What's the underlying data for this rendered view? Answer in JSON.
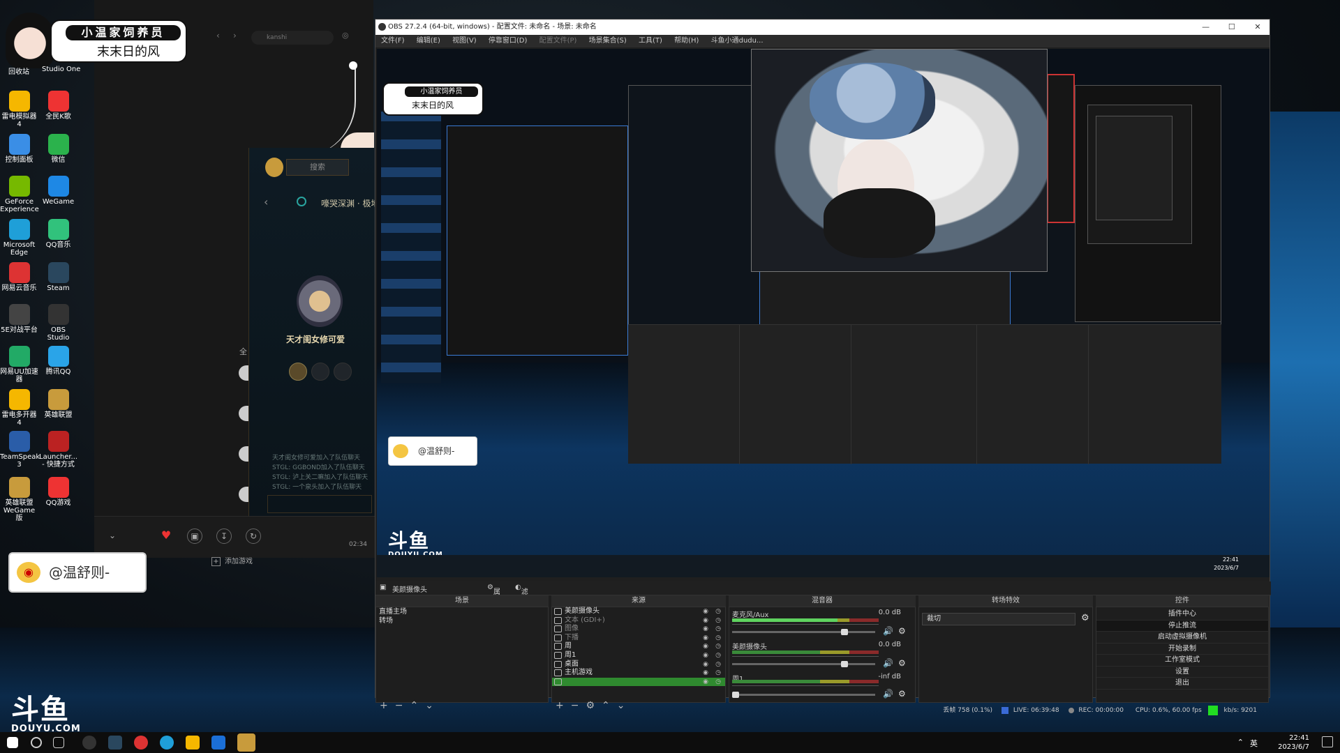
{
  "desktop": {
    "sticker": {
      "line1": "小温家饲养员",
      "line2": "末末日的风"
    },
    "top_labels": [
      "回收站",
      "Studio One"
    ],
    "icons": [
      {
        "label": "雷电模拟器4",
        "color": "#f5b700"
      },
      {
        "label": "全民K歌",
        "color": "#e33"
      },
      {
        "label": "控制面板",
        "color": "#3a8ee6"
      },
      {
        "label": "微信",
        "color": "#2bb24c"
      },
      {
        "label": "GeForce Experience",
        "color": "#76b900"
      },
      {
        "label": "WeGame",
        "color": "#1e88e5"
      },
      {
        "label": "Microsoft Edge",
        "color": "#1f9fd8"
      },
      {
        "label": "QQ音乐",
        "color": "#31c27c"
      },
      {
        "label": "网易云音乐",
        "color": "#d33"
      },
      {
        "label": "Steam",
        "color": "#2a475e"
      },
      {
        "label": "5E对战平台",
        "color": "#444"
      },
      {
        "label": "OBS Studio",
        "color": "#333"
      },
      {
        "label": "网易UU加速器",
        "color": "#2a6"
      },
      {
        "label": "腾讯QQ",
        "color": "#2aa4e8"
      },
      {
        "label": "雷电多开器4",
        "color": "#f5b700"
      },
      {
        "label": "英雄联盟",
        "color": "#c89b3c"
      },
      {
        "label": "TeamSpeak 3",
        "color": "#2a5da8"
      },
      {
        "label": "Launcher... - 快捷方式",
        "color": "#b22"
      },
      {
        "label": "英雄联盟WeGame版",
        "color": "#c89b3c"
      },
      {
        "label": "QQ游戏",
        "color": "#e33"
      }
    ]
  },
  "client": {
    "search_placeholder": "kanshi",
    "lol_search": "搜索",
    "lol_title": "嚎哭深渊 · 极地...",
    "summoner_name": "天才闺女修可爱",
    "side_label": "全",
    "chat_lines": [
      "天才闺女修可爱加入了队伍聊天",
      "STGL: GGBOND加入了队伍聊天",
      "STGL: 泸上关二嘛加入了队伍聊天",
      "STGL: 一个泉头加入了队伍聊天"
    ],
    "time": "02:34",
    "add_game": "添加游戏"
  },
  "weibo": {
    "handle": "@温舒则-"
  },
  "watermark": {
    "brand": "斗鱼",
    "domain": "DOUYU.COM"
  },
  "obs": {
    "title": "OBS 27.2.4 (64-bit, windows) - 配置文件: 未命名 - 场景: 未命名",
    "menu": [
      "文件(F)",
      "编辑(E)",
      "视图(V)",
      "停靠窗口(D)",
      "配置文件(P)",
      "场景集合(S)",
      "工具(T)",
      "帮助(H)",
      "斗鱼小通dudu..."
    ],
    "tabs": {
      "source_name": "美颜摄像头",
      "properties": "属性",
      "filters": "滤镜"
    },
    "docks": {
      "scenes": {
        "title": "场景",
        "items": [
          "直播主场",
          "转场"
        ]
      },
      "sources": {
        "title": "来源",
        "items": [
          {
            "name": "美颜摄像头",
            "selected": false
          },
          {
            "name": "文本 (GDI+)",
            "selected": false
          },
          {
            "name": "图像",
            "selected": false
          },
          {
            "name": "下播",
            "selected": false
          },
          {
            "name": "周",
            "selected": false
          },
          {
            "name": "周1",
            "selected": false
          },
          {
            "name": "桌面",
            "selected": false
          },
          {
            "name": "主机游戏",
            "selected": false
          },
          {
            "name": "",
            "selected": true
          }
        ]
      },
      "mixer": {
        "title": "混音器",
        "channels": [
          {
            "name": "麦克风/Aux",
            "db": "0.0 dB",
            "level": 0.72,
            "volume": 0.8
          },
          {
            "name": "美颜摄像头",
            "db": "0.0 dB",
            "level": 0.0,
            "volume": 0.8
          },
          {
            "name": "周1",
            "db": "-inf dB",
            "level": 0.0,
            "volume": 0.0
          }
        ]
      },
      "transitions": {
        "title": "转场特效",
        "selected": "裁切"
      },
      "controls": {
        "title": "控件",
        "buttons": [
          "插件中心",
          "停止推流",
          "启动虚拟摄像机",
          "开始录制",
          "工作室模式",
          "设置",
          "退出"
        ]
      }
    },
    "status": {
      "dropped": "丢帧 758 (0.1%)",
      "live": "LIVE: 06:39:48",
      "rec": "REC: 00:00:00",
      "cpu": "CPU: 0.6%, 60.00 fps",
      "bitrate": "kb/s: 9201"
    }
  },
  "taskbar": {
    "ime": "英",
    "time": "22:41",
    "date": "2023/6/7"
  }
}
